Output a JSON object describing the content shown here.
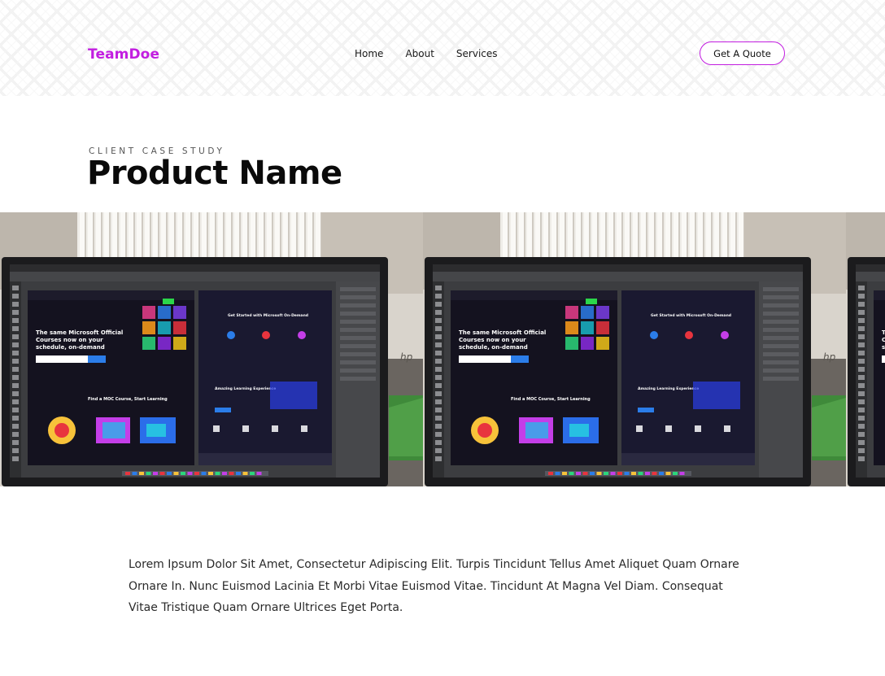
{
  "brand": {
    "name": "TeamDoe",
    "accent_color": "#c21ee0"
  },
  "nav": {
    "items": [
      {
        "label": "Home"
      },
      {
        "label": "About"
      },
      {
        "label": "Services"
      }
    ]
  },
  "cta": {
    "label": "Get A Quote"
  },
  "hero": {
    "eyebrow": "CLIENT CASE STUDY",
    "title": "Product Name"
  },
  "gallery": {
    "images": [
      {
        "alt": "Monitor showing design software with a course website mockup"
      },
      {
        "alt": "Monitor showing design software with a course website mockup"
      },
      {
        "alt": "Monitor showing design software with a course website mockup"
      }
    ]
  },
  "description": "Lorem Ipsum Dolor Sit Amet, Consectetur Adipiscing Elit. Turpis Tincidunt Tellus Amet Aliquet Quam Ornare Ornare In. Nunc Euismod Lacinia Et Morbi Vitae Euismod Vitae. Tincidunt At Magna Vel Diam. Consequat Vitae Tristique Quam Ornare Ultrices Eget Porta."
}
